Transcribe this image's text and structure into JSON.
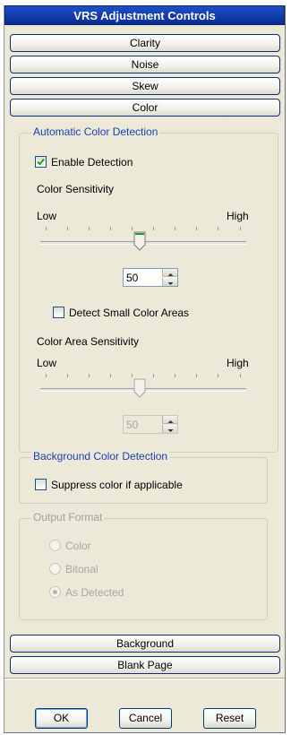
{
  "window": {
    "title": "VRS Adjustment Controls"
  },
  "sections_top": [
    {
      "label": "Clarity"
    },
    {
      "label": "Noise"
    },
    {
      "label": "Skew"
    },
    {
      "label": "Color"
    }
  ],
  "auto_color": {
    "legend": "Automatic Color Detection",
    "enable_detection": {
      "label": "Enable Detection",
      "checked": true
    },
    "color_sensitivity": {
      "label": "Color Sensitivity",
      "low_label": "Low",
      "high_label": "High",
      "value": "50",
      "slider_fraction": 0.5,
      "enabled": true
    },
    "detect_small_areas": {
      "label": "Detect Small Color Areas",
      "checked": false
    },
    "area_sensitivity": {
      "label": "Color Area Sensitivity",
      "low_label": "Low",
      "high_label": "High",
      "value": "50",
      "slider_fraction": 0.5,
      "enabled": false
    }
  },
  "background_color": {
    "legend": "Background Color Detection",
    "suppress": {
      "label": "Suppress color if applicable",
      "checked": false
    }
  },
  "output_format": {
    "legend": "Output Format",
    "enabled": false,
    "options": [
      {
        "label": "Color",
        "selected": false
      },
      {
        "label": "Bitonal",
        "selected": false
      },
      {
        "label": "As Detected",
        "selected": true
      }
    ]
  },
  "sections_bottom": [
    {
      "label": "Background"
    },
    {
      "label": "Blank Page"
    }
  ],
  "footer": {
    "ok_label": "OK",
    "cancel_label": "Cancel",
    "reset_label": "Reset"
  }
}
